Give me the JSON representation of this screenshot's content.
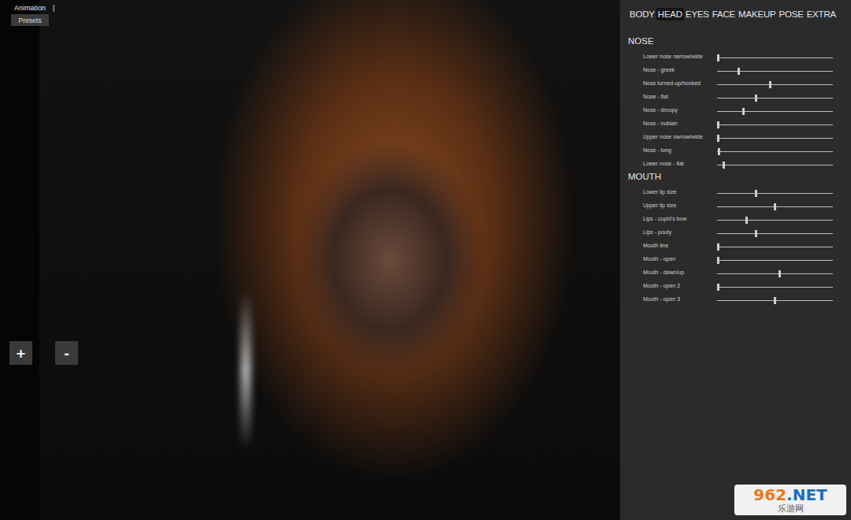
{
  "toolbar": {
    "animation_label": "Animation",
    "animation_cursor": "|",
    "presets_button": "Presets"
  },
  "zoom_buttons": [
    "+",
    "-"
  ],
  "viewport": {
    "content": "3D character render"
  },
  "tabs": [
    {
      "label": "BODY",
      "selected": false
    },
    {
      "label": "HEAD",
      "selected": true
    },
    {
      "label": "EYES",
      "selected": false
    },
    {
      "label": "FACE",
      "selected": false
    },
    {
      "label": "MAKEUP",
      "selected": false
    },
    {
      "label": "POSE",
      "selected": false
    },
    {
      "label": "EXTRA",
      "selected": false
    }
  ],
  "sections": [
    {
      "title": "NOSE",
      "sliders": [
        {
          "label": "Lower nose narrow/wide",
          "level": 0
        },
        {
          "label": "Nose - greek",
          "level": 0.18
        },
        {
          "label": "Nose turned-up/hooked",
          "level": 0.46
        },
        {
          "label": "Nose - flat",
          "level": 0.33
        },
        {
          "label": "Nose - droopy",
          "level": 0.22
        },
        {
          "label": "Nose - nubian",
          "level": 0
        },
        {
          "label": "Upper nose narrow/wide",
          "level": 0
        },
        {
          "label": "Nose - long",
          "level": 0.01
        },
        {
          "label": "Lower nose - flat",
          "level": 0.05
        }
      ]
    },
    {
      "title": "MOUTH",
      "sliders": [
        {
          "label": "Lower lip size",
          "level": 0.33
        },
        {
          "label": "Upper lip size",
          "level": 0.5
        },
        {
          "label": "Lips - cupid's bow",
          "level": 0.25
        },
        {
          "label": "Lips - pouty",
          "level": 0.33
        },
        {
          "label": "Mouth line",
          "level": 0
        },
        {
          "label": "Mouth - open",
          "level": 0
        },
        {
          "label": "Mouth - down/up",
          "level": 0.54
        },
        {
          "label": "Mouth - open 2",
          "level": 0
        },
        {
          "label": "Mouth - open 3",
          "level": 0.5
        }
      ]
    }
  ],
  "watermark": {
    "number": "962",
    "suffix": ".NET",
    "subtitle": "乐游网"
  }
}
